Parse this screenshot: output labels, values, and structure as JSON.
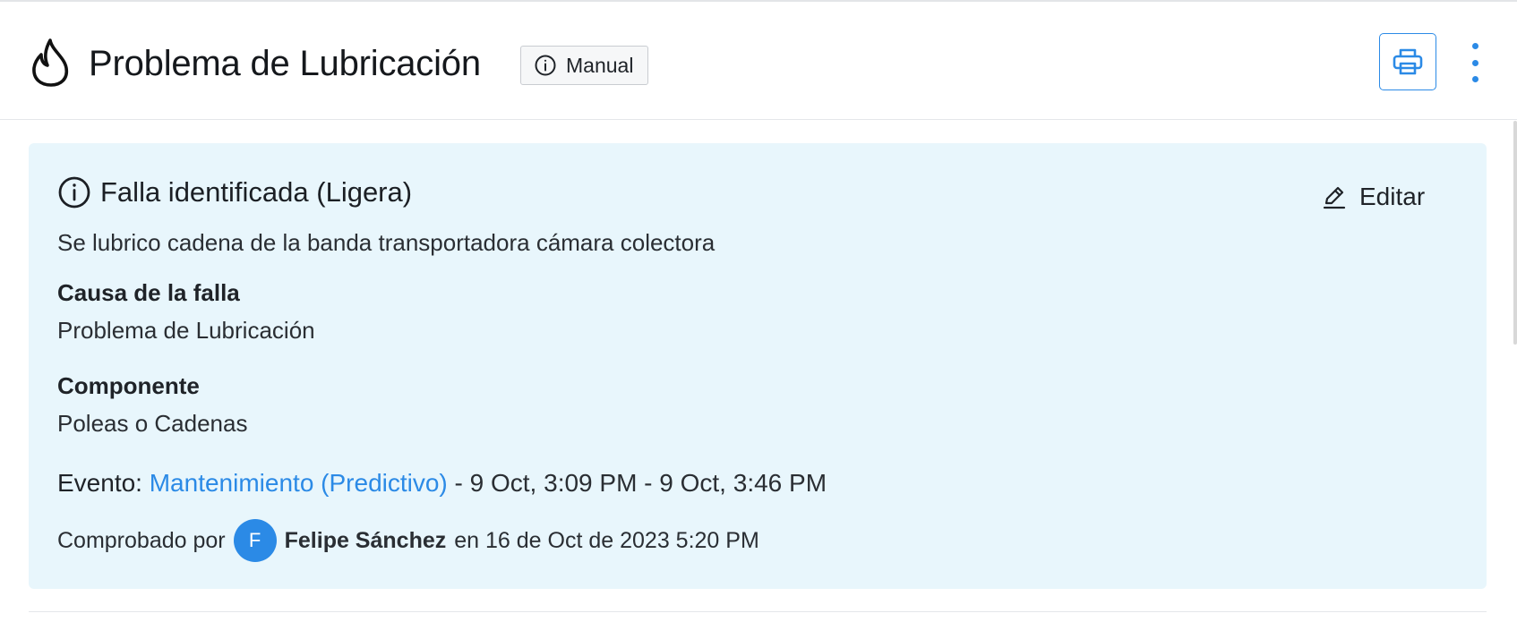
{
  "header": {
    "title": "Problema de Lubricación",
    "badge_label": "Manual",
    "icons": {
      "title": "flame-icon",
      "badge": "info-icon",
      "print": "printer-icon",
      "more": "more-vertical-icon"
    }
  },
  "card": {
    "title": "Falla identificada (Ligera)",
    "edit_label": "Editar",
    "description": "Se lubrico cadena de la banda transportadora cámara colectora",
    "cause_label": "Causa de la falla",
    "cause_value": "Problema de Lubricación",
    "component_label": "Componente",
    "component_value": "Poleas o Cadenas",
    "event_label": "Evento:",
    "event_link": "Mantenimiento (Predictivo)",
    "event_range": " - 9 Oct, 3:09 PM - 9 Oct, 3:46 PM",
    "checked_by_prefix": "Comprobado por",
    "checked_by_initial": "F",
    "checked_by_name": "Felipe Sánchez",
    "checked_by_suffix": "en 16 de Oct de 2023 5:20 PM",
    "icons": {
      "title": "info-icon",
      "edit": "pencil-icon"
    }
  },
  "colors": {
    "accent": "#2b8ae6",
    "card_background": "#e8f6fc",
    "text": "#1f2328"
  }
}
